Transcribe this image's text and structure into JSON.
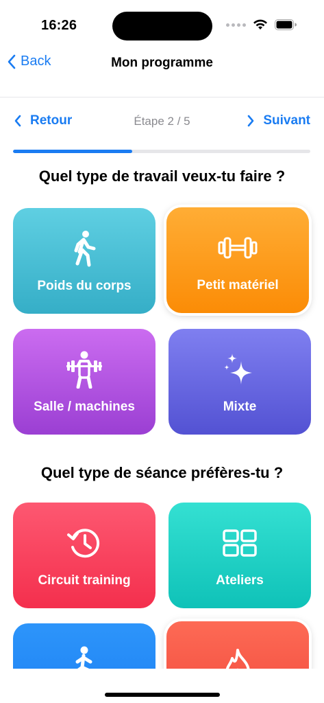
{
  "status": {
    "time": "16:26"
  },
  "nav": {
    "back_label": "Back",
    "title": "Mon programme"
  },
  "stepper": {
    "prev_label": "Retour",
    "step_text": "Étape 2 / 5",
    "next_label": "Suivant",
    "progress": 0.4
  },
  "sections": {
    "work_type": {
      "title": "Quel type de travail veux-tu faire ?",
      "options": [
        {
          "label": "Poids du corps",
          "icon": "walking-person-icon",
          "selected": false,
          "colors": [
            "#5fcfe2",
            "#35aec7"
          ]
        },
        {
          "label": "Petit matériel",
          "icon": "dumbbell-icon",
          "selected": true,
          "colors": [
            "#ffad35",
            "#fb8c06"
          ]
        },
        {
          "label": "Salle / machines",
          "icon": "weightlifter-icon",
          "selected": false,
          "colors": [
            "#cb6cf0",
            "#9b3fd3"
          ]
        },
        {
          "label": "Mixte",
          "icon": "sparkles-icon",
          "selected": false,
          "colors": [
            "#7f7ff0",
            "#5352d3"
          ]
        }
      ]
    },
    "session_type": {
      "title": "Quel type de séance préfères-tu ?",
      "options": [
        {
          "label": "Circuit training",
          "icon": "clock-history-icon",
          "selected": false,
          "colors": [
            "#fd5871",
            "#f42f4d"
          ]
        },
        {
          "label": "Ateliers",
          "icon": "grid-icon",
          "selected": false,
          "colors": [
            "#34e0d2",
            "#0fc2b8"
          ]
        },
        {
          "label": "",
          "icon": "lunge-person-icon",
          "selected": false,
          "colors": [
            "#2d95fa",
            "#1a7cf2"
          ]
        },
        {
          "label": "",
          "icon": "flame-icon",
          "selected": true,
          "colors": [
            "#fd6a55",
            "#f0473a"
          ]
        }
      ]
    }
  }
}
